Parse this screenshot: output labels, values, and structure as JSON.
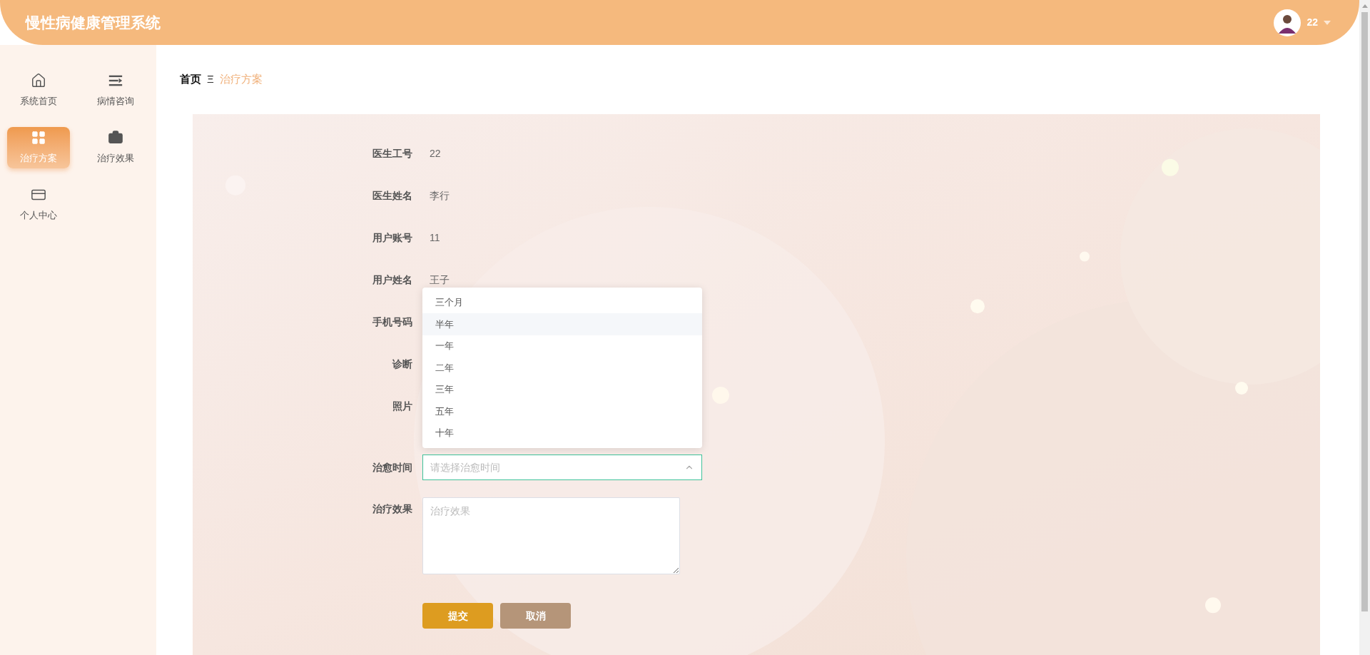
{
  "header": {
    "title": "慢性病健康管理系统",
    "user": "22"
  },
  "sidebar": {
    "items": [
      {
        "label": "系统首页",
        "kind": "home",
        "selected": false
      },
      {
        "label": "病情咨询",
        "kind": "list",
        "selected": false
      },
      {
        "label": "治疗方案",
        "kind": "grid",
        "selected": true
      },
      {
        "label": "治疗效果",
        "kind": "briefcase",
        "selected": false
      },
      {
        "label": "个人中心",
        "kind": "card",
        "selected": false
      }
    ]
  },
  "breadcrumb": {
    "home": "首页",
    "separator": "Ξ",
    "current": "治疗方案"
  },
  "form": {
    "fields": [
      {
        "kind": "text",
        "label": "医生工号",
        "value": "22"
      },
      {
        "kind": "text",
        "label": "医生姓名",
        "value": "李行"
      },
      {
        "kind": "text",
        "label": "用户账号",
        "value": "11"
      },
      {
        "kind": "text",
        "label": "用户姓名",
        "value": "王子"
      },
      {
        "kind": "covered",
        "label": "手机号码"
      },
      {
        "kind": "covered",
        "label": "诊断"
      },
      {
        "label": "照片"
      },
      {
        "kind": "select",
        "label": "治愈时间",
        "placeholder": "请选择治愈时间",
        "expanded": true,
        "options": [
          {
            "label": "三个月",
            "hovered": false
          },
          {
            "label": "半年",
            "hovered": true
          },
          {
            "label": "一年",
            "hovered": false
          },
          {
            "label": "二年",
            "hovered": false
          },
          {
            "label": "三年",
            "hovered": false
          },
          {
            "label": "五年",
            "hovered": false
          },
          {
            "label": "十年",
            "hovered": false
          }
        ]
      },
      {
        "kind": "textarea",
        "label": "治疗效果",
        "placeholder": "治疗效果"
      }
    ],
    "buttons": [
      {
        "label": "提交",
        "kind": "primary"
      },
      {
        "label": "取消",
        "kind": "secondary"
      }
    ]
  }
}
